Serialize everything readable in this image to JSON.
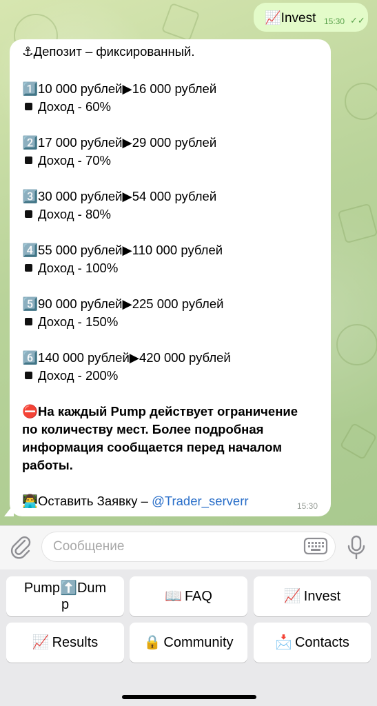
{
  "outgoing": {
    "emoji": "📈",
    "text": "Invest",
    "time": "15:30"
  },
  "incoming": {
    "header_emoji": "⚓",
    "header_text": "Депозит – фиксированный.",
    "tiers": [
      {
        "num": "1️⃣",
        "range": "10 000 рублей▶16 000 рублей",
        "income": "Доход - 60%"
      },
      {
        "num": "2️⃣",
        "range": "17 000 рублей▶29 000 рублей",
        "income": "Доход - 70%"
      },
      {
        "num": "3️⃣",
        "range": "30 000 рублей▶54 000 рублей",
        "income": "Доход - 80%"
      },
      {
        "num": "4️⃣",
        "range": "55 000 рублей▶110 000 рублей",
        "income": "Доход - 100%"
      },
      {
        "num": "5️⃣",
        "range": "90 000 рублей▶225 000 рублей",
        "income": "Доход - 150%"
      },
      {
        "num": "6️⃣",
        "range": "140 000 рублей▶420 000 рублей",
        "income": "Доход - 200%"
      }
    ],
    "warning_emoji": "⛔",
    "warning_lines": [
      "На каждый Pump действует ограничение",
      "по количеству мест. Более подробная",
      "информация сообщается перед началом",
      "работы."
    ],
    "contact_emoji": "👨‍💻",
    "contact_text": "Оставить Заявку – ",
    "contact_link": "@Trader_serverr",
    "time": "15:30"
  },
  "input": {
    "placeholder": "Сообщение"
  },
  "keyboard": {
    "row1": [
      {
        "emoji": "",
        "label_line1": "Pump⬆️Dum",
        "label_line2": "p"
      },
      {
        "emoji": "📖",
        "label": "FAQ"
      },
      {
        "emoji": "📈",
        "label": "Invest"
      }
    ],
    "row2": [
      {
        "emoji": "📈",
        "label": "Results"
      },
      {
        "emoji": "🔒",
        "label": "Community"
      },
      {
        "emoji": "📩",
        "label": "Contacts"
      }
    ]
  },
  "colors": {
    "outgoing_bubble": "#e3fbc9",
    "incoming_bubble": "#ffffff",
    "link": "#2a6fc9",
    "check": "#58a04a"
  }
}
